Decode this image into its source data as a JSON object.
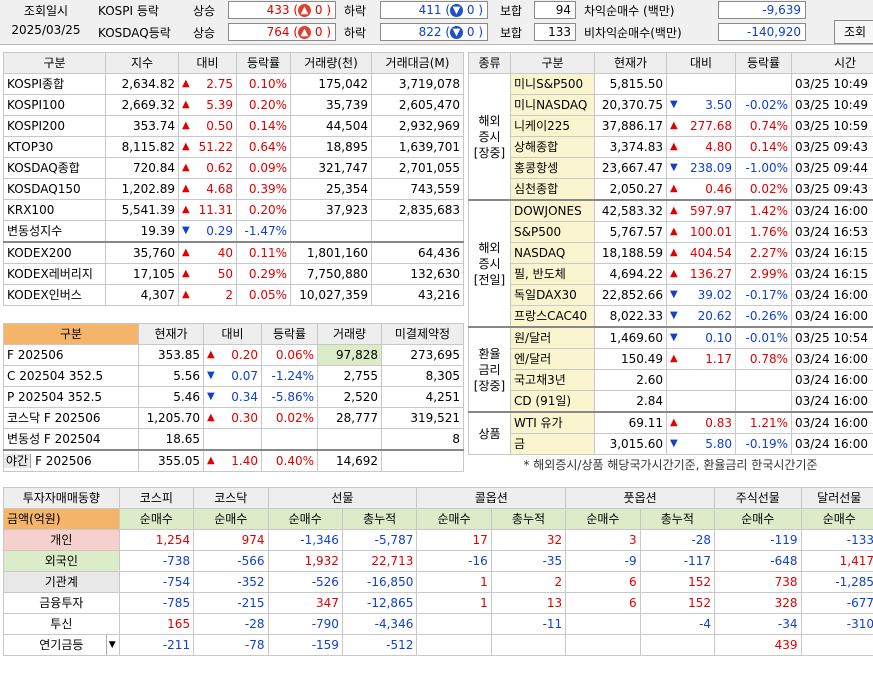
{
  "top": {
    "date_label": "조회일시",
    "date": "2025/03/25",
    "kospi": {
      "name": "KOSPI 등락",
      "up_label": "상승",
      "up": "433",
      "up_lim": "0",
      "down_label": "하락",
      "down": "411",
      "down_lim": "0",
      "flat_label": "보합",
      "flat": "94"
    },
    "kosdaq": {
      "name": "KOSDAQ등락",
      "up_label": "상승",
      "up": "764",
      "up_lim": "0",
      "down_label": "하락",
      "down": "822",
      "down_lim": "0",
      "flat_label": "보합",
      "flat": "133"
    },
    "arb_label": "차익순매수 (백만)",
    "arb": "-9,639",
    "nonarb_label": "비차익순매수(백만)",
    "nonarb": "-140,920",
    "query_button": "조회"
  },
  "index_table": {
    "headers": [
      "구분",
      "지수",
      "대비",
      "등락률",
      "거래량(천)",
      "거래대금(M)"
    ],
    "rows": [
      {
        "name": "KOSPI종합",
        "val": "2,634.82",
        "dir": "up",
        "chg": "2.75",
        "pct": "0.10%",
        "vol": "175,042",
        "amt": "3,719,078"
      },
      {
        "name": "KOSPI100",
        "val": "2,669.32",
        "dir": "up",
        "chg": "5.39",
        "pct": "0.20%",
        "vol": "35,739",
        "amt": "2,605,470"
      },
      {
        "name": "KOSPI200",
        "val": "353.74",
        "dir": "up",
        "chg": "0.50",
        "pct": "0.14%",
        "vol": "44,504",
        "amt": "2,932,969"
      },
      {
        "name": "KTOP30",
        "val": "8,115.82",
        "dir": "up",
        "chg": "51.22",
        "pct": "0.64%",
        "vol": "18,895",
        "amt": "1,639,701"
      },
      {
        "name": "KOSDAQ종합",
        "val": "720.84",
        "dir": "up",
        "chg": "0.62",
        "pct": "0.09%",
        "vol": "321,747",
        "amt": "2,701,055"
      },
      {
        "name": "KOSDAQ150",
        "val": "1,202.89",
        "dir": "up",
        "chg": "4.68",
        "pct": "0.39%",
        "vol": "25,354",
        "amt": "743,559"
      },
      {
        "name": "KRX100",
        "val": "5,541.39",
        "dir": "up",
        "chg": "11.31",
        "pct": "0.20%",
        "vol": "37,923",
        "amt": "2,835,683"
      },
      {
        "name": "변동성지수",
        "val": "19.39",
        "dir": "down",
        "chg": "0.29",
        "pct": "-1.47%",
        "vol": "",
        "amt": ""
      },
      {
        "name": "KODEX200",
        "val": "35,760",
        "dir": "up",
        "chg": "40",
        "pct": "0.11%",
        "vol": "1,801,160",
        "amt": "64,436"
      },
      {
        "name": "KODEX레버리지",
        "val": "17,105",
        "dir": "up",
        "chg": "50",
        "pct": "0.29%",
        "vol": "7,750,880",
        "amt": "132,630"
      },
      {
        "name": "KODEX인버스",
        "val": "4,307",
        "dir": "up",
        "chg": "2",
        "pct": "0.05%",
        "vol": "10,027,359",
        "amt": "43,216"
      }
    ]
  },
  "futures_table": {
    "headers": [
      "구분",
      "현재가",
      "대비",
      "등락률",
      "거래량",
      "미결제약정"
    ],
    "rows": [
      {
        "name": "F 202506",
        "val": "353.85",
        "dir": "up",
        "chg": "0.20",
        "pct": "0.06%",
        "vol": "97,828",
        "oi": "273,695"
      },
      {
        "name": "C 202504 352.5",
        "val": "5.56",
        "dir": "down",
        "chg": "0.07",
        "pct": "-1.24%",
        "vol": "2,755",
        "oi": "8,305"
      },
      {
        "name": "P 202504 352.5",
        "val": "5.46",
        "dir": "down",
        "chg": "0.34",
        "pct": "-5.86%",
        "vol": "2,520",
        "oi": "4,251"
      },
      {
        "name": "코스닥 F 202506",
        "val": "1,205.70",
        "dir": "up",
        "chg": "0.30",
        "pct": "0.02%",
        "vol": "28,777",
        "oi": "319,521"
      },
      {
        "name": "변동성 F 202504",
        "val": "18.65",
        "dir": "",
        "chg": "",
        "pct": "",
        "vol": "",
        "oi": "8"
      }
    ],
    "night": {
      "tag": "야간",
      "name": "F 202506",
      "val": "355.05",
      "dir": "up",
      "chg": "1.40",
      "pct": "0.40%",
      "vol": "14,692",
      "oi": ""
    }
  },
  "world_table": {
    "headers": [
      "종류",
      "구분",
      "현재가",
      "대비",
      "등락률",
      "시간"
    ],
    "groups": [
      {
        "label": "해외\n증시\n[장중]",
        "rows": [
          {
            "name": "미니S&P500",
            "val": "5,815.50",
            "dir": "",
            "chg": "",
            "pct": "",
            "time": "03/25 10:49"
          },
          {
            "name": "미니NASDAQ",
            "val": "20,370.75",
            "dir": "down",
            "chg": "3.50",
            "pct": "-0.02%",
            "time": "03/25 10:49"
          },
          {
            "name": "니케이225",
            "val": "37,886.17",
            "dir": "up",
            "chg": "277.68",
            "pct": "0.74%",
            "time": "03/25 10:59"
          },
          {
            "name": "상해종합",
            "val": "3,374.83",
            "dir": "up",
            "chg": "4.80",
            "pct": "0.14%",
            "time": "03/25 09:43"
          },
          {
            "name": "홍콩항셍",
            "val": "23,667.47",
            "dir": "down",
            "chg": "238.09",
            "pct": "-1.00%",
            "time": "03/25 09:44"
          },
          {
            "name": "심천종합",
            "val": "2,050.27",
            "dir": "up",
            "chg": "0.46",
            "pct": "0.02%",
            "time": "03/25 09:43"
          }
        ]
      },
      {
        "label": "해외\n증시\n[전일]",
        "rows": [
          {
            "name": "DOWJONES",
            "val": "42,583.32",
            "dir": "up",
            "chg": "597.97",
            "pct": "1.42%",
            "time": "03/24 16:00"
          },
          {
            "name": "S&P500",
            "val": "5,767.57",
            "dir": "up",
            "chg": "100.01",
            "pct": "1.76%",
            "time": "03/24 16:53"
          },
          {
            "name": "NASDAQ",
            "val": "18,188.59",
            "dir": "up",
            "chg": "404.54",
            "pct": "2.27%",
            "time": "03/24 16:15"
          },
          {
            "name": "필, 반도체",
            "val": "4,694.22",
            "dir": "up",
            "chg": "136.27",
            "pct": "2.99%",
            "time": "03/24 16:15"
          },
          {
            "name": "독일DAX30",
            "val": "22,852.66",
            "dir": "down",
            "chg": "39.02",
            "pct": "-0.17%",
            "time": "03/24 16:00"
          },
          {
            "name": "프랑스CAC40",
            "val": "8,022.33",
            "dir": "down",
            "chg": "20.62",
            "pct": "-0.26%",
            "time": "03/24 16:00"
          }
        ]
      },
      {
        "label": "환율\n금리\n[장중]",
        "rows": [
          {
            "name": "원/달러",
            "val": "1,469.60",
            "dir": "down",
            "chg": "0.10",
            "pct": "-0.01%",
            "time": "03/25 10:54"
          },
          {
            "name": "엔/달러",
            "val": "150.49",
            "dir": "up",
            "chg": "1.17",
            "pct": "0.78%",
            "time": "03/24 16:00"
          },
          {
            "name": "국고채3년",
            "val": "2.60",
            "dir": "",
            "chg": "",
            "pct": "",
            "time": "03/24 16:00"
          },
          {
            "name": "CD (91일)",
            "val": "2.84",
            "dir": "",
            "chg": "",
            "pct": "",
            "time": "03/24 16:00"
          }
        ]
      },
      {
        "label": "상품",
        "rows": [
          {
            "name": "WTI 유가",
            "val": "69.11",
            "dir": "up",
            "chg": "0.83",
            "pct": "1.21%",
            "time": "03/24 16:00"
          },
          {
            "name": "금",
            "val": "3,015.60",
            "dir": "down",
            "chg": "5.80",
            "pct": "-0.19%",
            "time": "03/24 16:00"
          }
        ]
      }
    ],
    "footnote": "* 해외증시/상품 해당국가시간기준, 환율금리 한국시간기준"
  },
  "investor": {
    "title": "투자자매매동향",
    "groups": [
      "코스피",
      "코스닥",
      "선물",
      "콜옵션",
      "풋옵션",
      "주식선물",
      "달러선물"
    ],
    "unit_label": "금액(억원)",
    "subheaders": [
      "순매수",
      "순매수",
      "순매수",
      "총누적",
      "순매수",
      "총누적",
      "순매수",
      "총누적",
      "순매수",
      "순매수"
    ],
    "rows": [
      {
        "name": "개인",
        "vals": [
          "1,254",
          "974",
          "-1,346",
          "-5,787",
          "17",
          "32",
          "3",
          "-28",
          "-119",
          "-133"
        ]
      },
      {
        "name": "외국인",
        "vals": [
          "-738",
          "-566",
          "1,932",
          "22,713",
          "-16",
          "-35",
          "-9",
          "-117",
          "-648",
          "1,417"
        ]
      },
      {
        "name": "기관계",
        "vals": [
          "-754",
          "-352",
          "-526",
          "-16,850",
          "1",
          "2",
          "6",
          "152",
          "738",
          "-1,285"
        ]
      },
      {
        "name": "금융투자",
        "vals": [
          "-785",
          "-215",
          "347",
          "-12,865",
          "1",
          "13",
          "6",
          "152",
          "328",
          "-677"
        ]
      },
      {
        "name": "투신",
        "vals": [
          "165",
          "-28",
          "-790",
          "-4,346",
          "",
          "-11",
          "",
          "-4",
          "-34",
          "-310"
        ]
      },
      {
        "name": "연기금등",
        "vals": [
          "-211",
          "-78",
          "-159",
          "-512",
          "",
          "",
          "",
          "",
          "439",
          ""
        ]
      }
    ]
  }
}
